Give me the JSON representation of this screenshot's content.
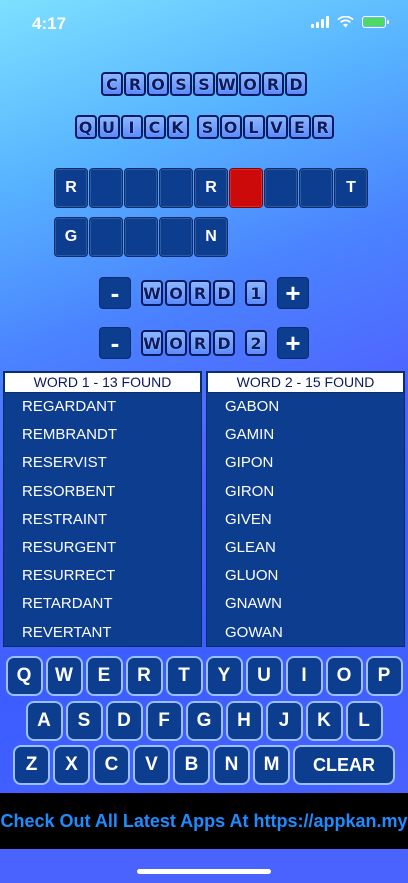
{
  "status": {
    "time": "4:17"
  },
  "title": {
    "line1": "CROSSWORD",
    "line2a": "QUICK",
    "line2b": "SOLVER"
  },
  "grid": {
    "word1": [
      "R",
      "",
      "",
      "",
      "R",
      "",
      "",
      "",
      "T"
    ],
    "word1_selected_index": 5,
    "word2": [
      "G",
      "",
      "",
      "",
      "N"
    ]
  },
  "controls": {
    "minus": "-",
    "plus": "+",
    "word1_label": "WORD",
    "word1_num": "1",
    "word2_label": "WORD",
    "word2_num": "2"
  },
  "lists": {
    "word1": {
      "header": "WORD 1 - 13 FOUND",
      "items": [
        "REGARDANT",
        "REMBRANDT",
        "RESERVIST",
        "RESORBENT",
        "RESTRAINT",
        "RESURGENT",
        "RESURRECT",
        "RETARDANT",
        "REVERTANT"
      ]
    },
    "word2": {
      "header": "WORD 2 - 15 FOUND",
      "items": [
        "GABON",
        "GAMIN",
        "GIPON",
        "GIRON",
        "GIVEN",
        "GLEAN",
        "GLUON",
        "GNAWN",
        "GOWAN"
      ]
    }
  },
  "keyboard": {
    "row1": [
      "Q",
      "W",
      "E",
      "R",
      "T",
      "Y",
      "U",
      "I",
      "O",
      "P"
    ],
    "row2": [
      "A",
      "S",
      "D",
      "F",
      "G",
      "H",
      "J",
      "K",
      "L"
    ],
    "row3": [
      "Z",
      "X",
      "C",
      "V",
      "B",
      "N",
      "M"
    ],
    "clear": "CLEAR"
  },
  "banner": {
    "text": "Check Out All Latest Apps At https://appkan.my"
  },
  "colors": {
    "tile_blue": "#0c3d8f",
    "selected_red": "#cc0a0a",
    "banner_text": "#1e8cff"
  }
}
